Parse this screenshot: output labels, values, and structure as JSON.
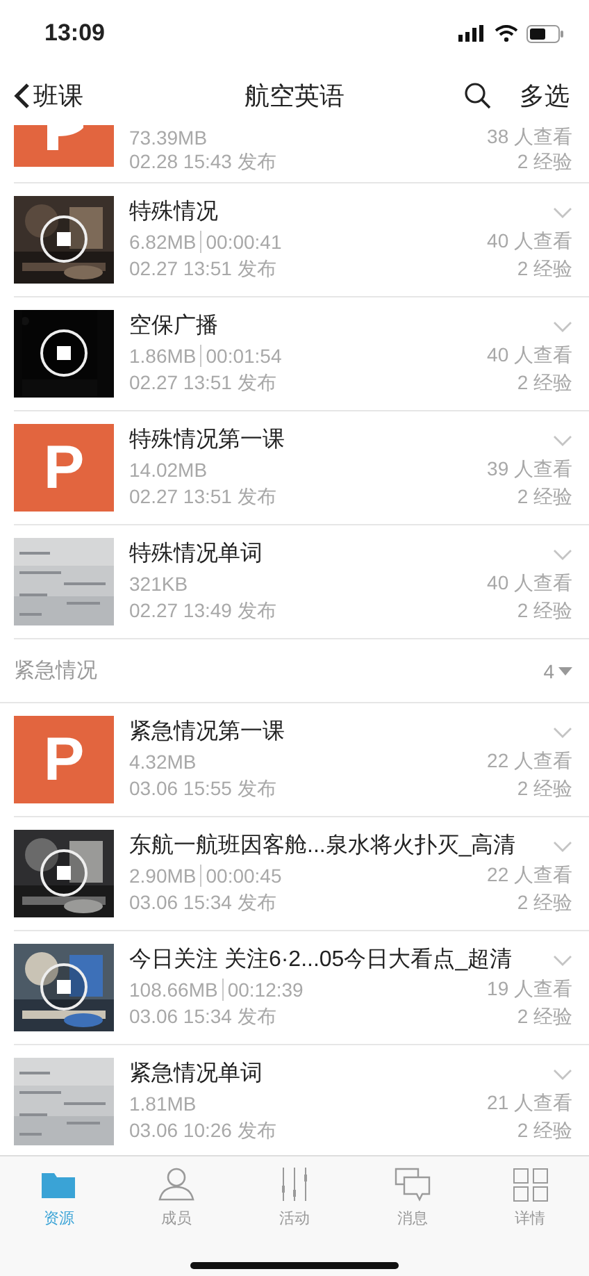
{
  "status_bar": {
    "time": "13:09"
  },
  "nav": {
    "back": "班课",
    "title": "航空英语",
    "action": "多选"
  },
  "groups": [
    {
      "items": [
        {
          "kind": "ppt",
          "size": "73.39MB",
          "date": "02.28 15:43 发布",
          "views": "38 人查看",
          "exp": "2 经验"
        },
        {
          "kind": "video",
          "title": "特殊情况",
          "size": "6.82MB",
          "duration": "00:00:41",
          "date": "02.27 13:51 发布",
          "views": "40 人查看",
          "exp": "2 经验"
        },
        {
          "kind": "video",
          "title": "空保广播",
          "size": "1.86MB",
          "duration": "00:01:54",
          "date": "02.27 13:51 发布",
          "views": "40 人查看",
          "exp": "2 经验"
        },
        {
          "kind": "ppt",
          "label": "P",
          "title": "特殊情况第一课",
          "size": "14.02MB",
          "date": "02.27 13:51 发布",
          "views": "39 人查看",
          "exp": "2 经验"
        },
        {
          "title": "特殊情况单词",
          "size": "321KB",
          "date": "02.27 13:49 发布",
          "views": "40 人查看",
          "exp": "2 经验"
        }
      ]
    },
    {
      "header": "紧急情况",
      "count": "4",
      "items": [
        {
          "kind": "ppt",
          "label": "P",
          "title": "紧急情况第一课",
          "size": "4.32MB",
          "date": "03.06 15:55 发布",
          "views": "22 人查看",
          "exp": "2 经验"
        },
        {
          "kind": "video",
          "title": "东航一航班因客舱...泉水将火扑灭_高清",
          "size": "2.90MB",
          "duration": "00:00:45",
          "date": "03.06 15:34 发布",
          "views": "22 人查看",
          "exp": "2 经验"
        },
        {
          "kind": "video",
          "title": "今日关注 关注6·2...05今日大看点_超清",
          "size": "108.66MB",
          "duration": "00:12:39",
          "date": "03.06 15:34 发布",
          "views": "19 人查看",
          "exp": "2 经验"
        },
        {
          "title": "紧急情况单词",
          "size": "1.81MB",
          "date": "03.06 10:26 发布",
          "views": "21 人查看",
          "exp": "2 经验"
        }
      ]
    }
  ],
  "tabs": [
    {
      "kind": "folder",
      "label": "资源",
      "selected": true
    },
    {
      "kind": "person",
      "label": "成员",
      "selected": false
    },
    {
      "kind": "sliders",
      "label": "活动",
      "selected": false
    },
    {
      "kind": "chat",
      "label": "消息",
      "selected": false
    },
    {
      "kind": "grid",
      "label": "详情",
      "selected": false
    }
  ]
}
